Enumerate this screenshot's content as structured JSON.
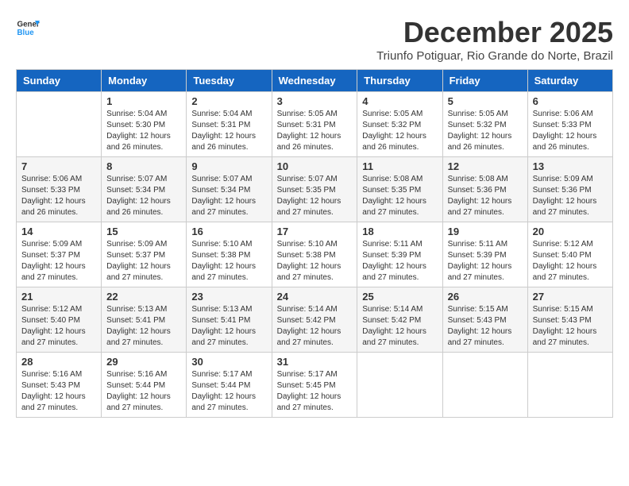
{
  "logo": {
    "general": "General",
    "blue": "Blue"
  },
  "header": {
    "title": "December 2025",
    "subtitle": "Triunfo Potiguar, Rio Grande do Norte, Brazil"
  },
  "weekdays": [
    "Sunday",
    "Monday",
    "Tuesday",
    "Wednesday",
    "Thursday",
    "Friday",
    "Saturday"
  ],
  "weeks": [
    [
      {
        "day": "",
        "sunrise": "",
        "sunset": "",
        "daylight": ""
      },
      {
        "day": "1",
        "sunrise": "Sunrise: 5:04 AM",
        "sunset": "Sunset: 5:30 PM",
        "daylight": "Daylight: 12 hours and 26 minutes."
      },
      {
        "day": "2",
        "sunrise": "Sunrise: 5:04 AM",
        "sunset": "Sunset: 5:31 PM",
        "daylight": "Daylight: 12 hours and 26 minutes."
      },
      {
        "day": "3",
        "sunrise": "Sunrise: 5:05 AM",
        "sunset": "Sunset: 5:31 PM",
        "daylight": "Daylight: 12 hours and 26 minutes."
      },
      {
        "day": "4",
        "sunrise": "Sunrise: 5:05 AM",
        "sunset": "Sunset: 5:32 PM",
        "daylight": "Daylight: 12 hours and 26 minutes."
      },
      {
        "day": "5",
        "sunrise": "Sunrise: 5:05 AM",
        "sunset": "Sunset: 5:32 PM",
        "daylight": "Daylight: 12 hours and 26 minutes."
      },
      {
        "day": "6",
        "sunrise": "Sunrise: 5:06 AM",
        "sunset": "Sunset: 5:33 PM",
        "daylight": "Daylight: 12 hours and 26 minutes."
      }
    ],
    [
      {
        "day": "7",
        "sunrise": "Sunrise: 5:06 AM",
        "sunset": "Sunset: 5:33 PM",
        "daylight": "Daylight: 12 hours and 26 minutes."
      },
      {
        "day": "8",
        "sunrise": "Sunrise: 5:07 AM",
        "sunset": "Sunset: 5:34 PM",
        "daylight": "Daylight: 12 hours and 26 minutes."
      },
      {
        "day": "9",
        "sunrise": "Sunrise: 5:07 AM",
        "sunset": "Sunset: 5:34 PM",
        "daylight": "Daylight: 12 hours and 27 minutes."
      },
      {
        "day": "10",
        "sunrise": "Sunrise: 5:07 AM",
        "sunset": "Sunset: 5:35 PM",
        "daylight": "Daylight: 12 hours and 27 minutes."
      },
      {
        "day": "11",
        "sunrise": "Sunrise: 5:08 AM",
        "sunset": "Sunset: 5:35 PM",
        "daylight": "Daylight: 12 hours and 27 minutes."
      },
      {
        "day": "12",
        "sunrise": "Sunrise: 5:08 AM",
        "sunset": "Sunset: 5:36 PM",
        "daylight": "Daylight: 12 hours and 27 minutes."
      },
      {
        "day": "13",
        "sunrise": "Sunrise: 5:09 AM",
        "sunset": "Sunset: 5:36 PM",
        "daylight": "Daylight: 12 hours and 27 minutes."
      }
    ],
    [
      {
        "day": "14",
        "sunrise": "Sunrise: 5:09 AM",
        "sunset": "Sunset: 5:37 PM",
        "daylight": "Daylight: 12 hours and 27 minutes."
      },
      {
        "day": "15",
        "sunrise": "Sunrise: 5:09 AM",
        "sunset": "Sunset: 5:37 PM",
        "daylight": "Daylight: 12 hours and 27 minutes."
      },
      {
        "day": "16",
        "sunrise": "Sunrise: 5:10 AM",
        "sunset": "Sunset: 5:38 PM",
        "daylight": "Daylight: 12 hours and 27 minutes."
      },
      {
        "day": "17",
        "sunrise": "Sunrise: 5:10 AM",
        "sunset": "Sunset: 5:38 PM",
        "daylight": "Daylight: 12 hours and 27 minutes."
      },
      {
        "day": "18",
        "sunrise": "Sunrise: 5:11 AM",
        "sunset": "Sunset: 5:39 PM",
        "daylight": "Daylight: 12 hours and 27 minutes."
      },
      {
        "day": "19",
        "sunrise": "Sunrise: 5:11 AM",
        "sunset": "Sunset: 5:39 PM",
        "daylight": "Daylight: 12 hours and 27 minutes."
      },
      {
        "day": "20",
        "sunrise": "Sunrise: 5:12 AM",
        "sunset": "Sunset: 5:40 PM",
        "daylight": "Daylight: 12 hours and 27 minutes."
      }
    ],
    [
      {
        "day": "21",
        "sunrise": "Sunrise: 5:12 AM",
        "sunset": "Sunset: 5:40 PM",
        "daylight": "Daylight: 12 hours and 27 minutes."
      },
      {
        "day": "22",
        "sunrise": "Sunrise: 5:13 AM",
        "sunset": "Sunset: 5:41 PM",
        "daylight": "Daylight: 12 hours and 27 minutes."
      },
      {
        "day": "23",
        "sunrise": "Sunrise: 5:13 AM",
        "sunset": "Sunset: 5:41 PM",
        "daylight": "Daylight: 12 hours and 27 minutes."
      },
      {
        "day": "24",
        "sunrise": "Sunrise: 5:14 AM",
        "sunset": "Sunset: 5:42 PM",
        "daylight": "Daylight: 12 hours and 27 minutes."
      },
      {
        "day": "25",
        "sunrise": "Sunrise: 5:14 AM",
        "sunset": "Sunset: 5:42 PM",
        "daylight": "Daylight: 12 hours and 27 minutes."
      },
      {
        "day": "26",
        "sunrise": "Sunrise: 5:15 AM",
        "sunset": "Sunset: 5:43 PM",
        "daylight": "Daylight: 12 hours and 27 minutes."
      },
      {
        "day": "27",
        "sunrise": "Sunrise: 5:15 AM",
        "sunset": "Sunset: 5:43 PM",
        "daylight": "Daylight: 12 hours and 27 minutes."
      }
    ],
    [
      {
        "day": "28",
        "sunrise": "Sunrise: 5:16 AM",
        "sunset": "Sunset: 5:43 PM",
        "daylight": "Daylight: 12 hours and 27 minutes."
      },
      {
        "day": "29",
        "sunrise": "Sunrise: 5:16 AM",
        "sunset": "Sunset: 5:44 PM",
        "daylight": "Daylight: 12 hours and 27 minutes."
      },
      {
        "day": "30",
        "sunrise": "Sunrise: 5:17 AM",
        "sunset": "Sunset: 5:44 PM",
        "daylight": "Daylight: 12 hours and 27 minutes."
      },
      {
        "day": "31",
        "sunrise": "Sunrise: 5:17 AM",
        "sunset": "Sunset: 5:45 PM",
        "daylight": "Daylight: 12 hours and 27 minutes."
      },
      {
        "day": "",
        "sunrise": "",
        "sunset": "",
        "daylight": ""
      },
      {
        "day": "",
        "sunrise": "",
        "sunset": "",
        "daylight": ""
      },
      {
        "day": "",
        "sunrise": "",
        "sunset": "",
        "daylight": ""
      }
    ]
  ]
}
